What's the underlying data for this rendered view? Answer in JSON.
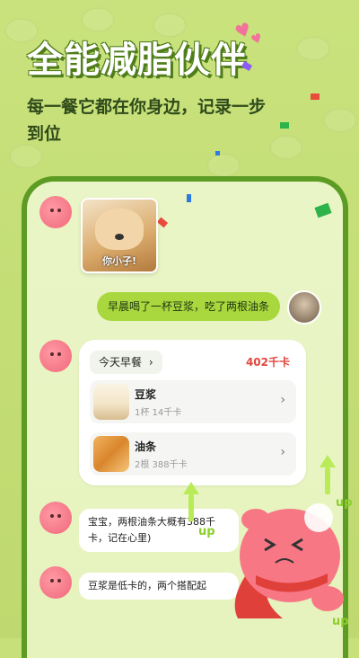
{
  "headline": "全能减脂伙伴",
  "subtitle": "每一餐它都在你身边，记录一步到位",
  "chat": {
    "sticker_caption": "你小子!",
    "user_message": "早晨喝了一杯豆浆，吃了两根油条",
    "meal_card": {
      "label": "今天早餐",
      "chevron": "›",
      "total": "402千卡",
      "items": [
        {
          "name": "豆浆",
          "detail": "1杯 14千卡",
          "chevron": "›"
        },
        {
          "name": "油条",
          "detail": "2根 388千卡",
          "chevron": "›"
        }
      ]
    },
    "bot_message_1": "宝宝，两根油条大概有388千卡，记在心里)",
    "bot_message_2": "豆浆是低卡的，两个搭配起"
  },
  "decor": {
    "up_labels": [
      "up",
      "up",
      "up"
    ],
    "accent_color": "#5d9c24",
    "bubble_color": "#a8d83e",
    "total_color": "#e0473d"
  }
}
